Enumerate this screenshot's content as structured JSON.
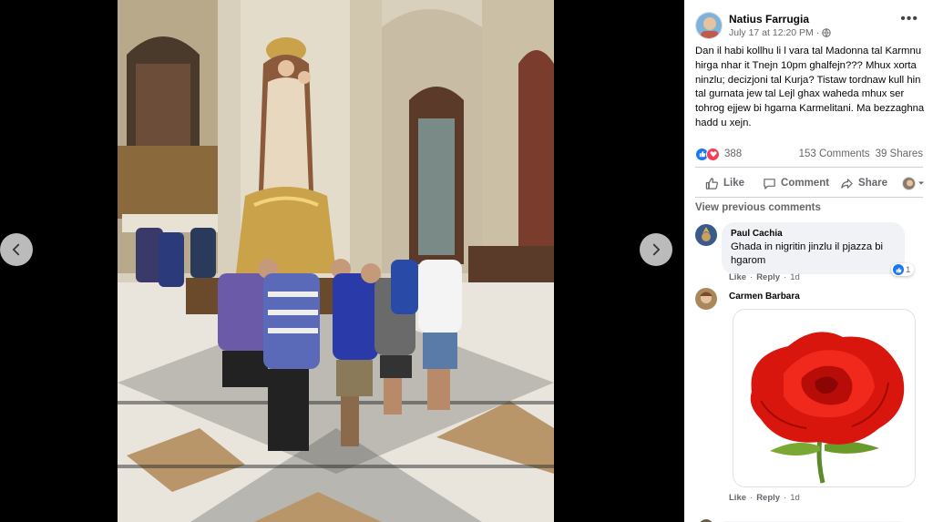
{
  "viewer": {
    "prev_icon": "chevron-left-icon",
    "next_icon": "chevron-right-icon"
  },
  "post": {
    "author": "Natius Farrugia",
    "date": "July 17 at 12:20 PM",
    "separator": "·",
    "audience_icon": "globe-icon",
    "more_label": "•••",
    "text": "Dan il habi kollhu li l vara tal Madonna tal Karmnu hirga nhar it Tnejn 10pm ghalfejn??? Mhux xorta ninzlu; decizjoni tal Kurja? Tistaw tordnaw kull hin tal gurnata jew tal Lejl ghax waheda mhux ser tohrog ejjew bi hgarna Karmelitani. Ma bezzaghna hadd u xejn.",
    "reaction_count": "388",
    "comments_count": "153 Comments",
    "shares_count": "39 Shares"
  },
  "actions": {
    "like": "Like",
    "comment": "Comment",
    "share": "Share"
  },
  "view_previous": "View previous comments",
  "comments": [
    {
      "name": "Paul Cachia",
      "text": "Ghada in nigritin jinzlu il pjazza bi hgarom",
      "like": "Like",
      "reply": "Reply",
      "dot": "·",
      "time": "1d",
      "reactions": "1"
    },
    {
      "name": "Carmen Barbara",
      "sticker": "red-rose-sticker",
      "like": "Like",
      "reply": "Reply",
      "dot": "·",
      "time": "1d"
    }
  ],
  "colors": {
    "like_blue": "#1877f2",
    "love_red": "#f33e58",
    "secondary_text": "#65676b",
    "bubble_bg": "#f0f2f5"
  }
}
